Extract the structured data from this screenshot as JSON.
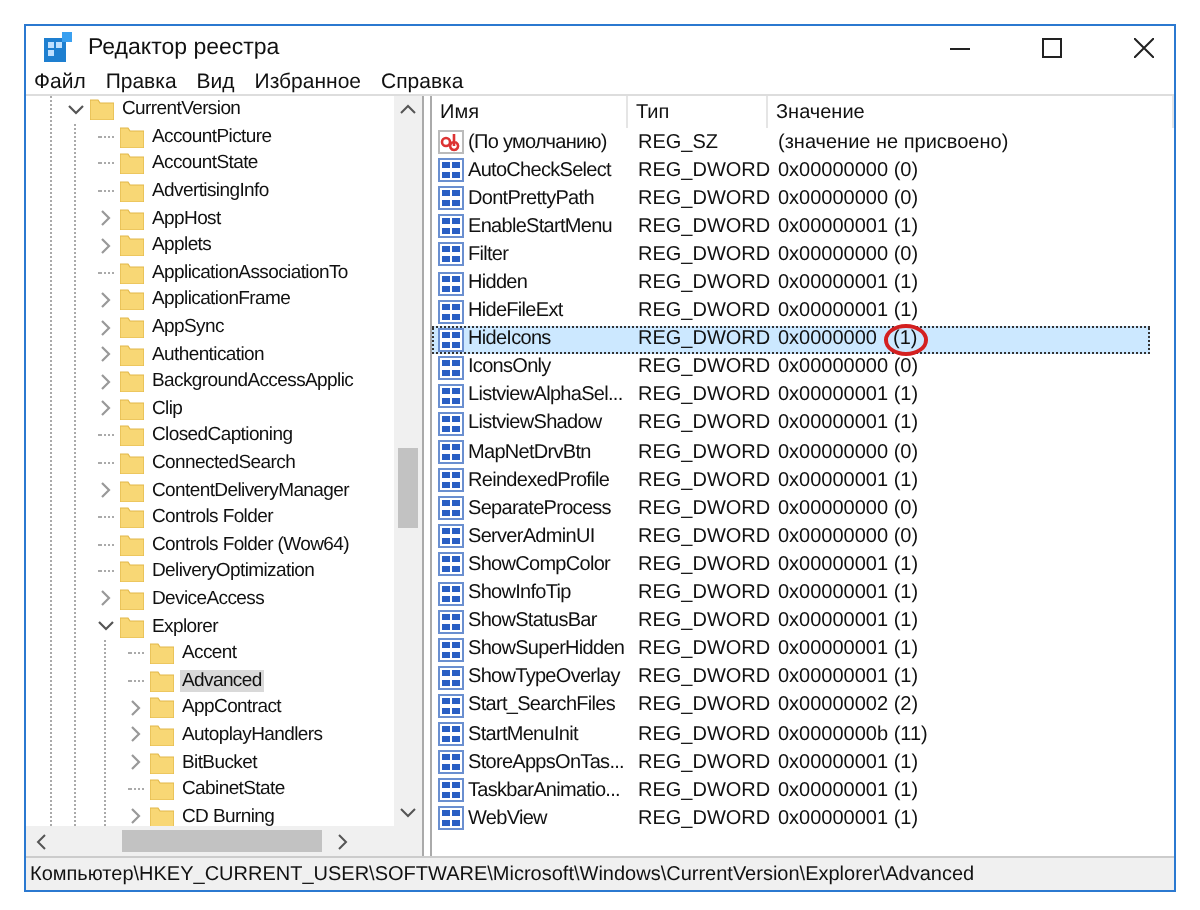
{
  "window": {
    "title": "Редактор реестра"
  },
  "menu": [
    "Файл",
    "Правка",
    "Вид",
    "Избранное",
    "Справка"
  ],
  "tree": [
    {
      "label": "CurrentVersion",
      "expandable": true,
      "selected": false,
      "children": [
        {
          "label": "AccountPicture",
          "expandable": false,
          "selected": false
        },
        {
          "label": "AccountState",
          "expandable": false,
          "selected": false
        },
        {
          "label": "AdvertisingInfo",
          "expandable": false,
          "selected": false
        },
        {
          "label": "AppHost",
          "expandable": true,
          "selected": false
        },
        {
          "label": "Applets",
          "expandable": true,
          "selected": false
        },
        {
          "label": "ApplicationAssociationTo",
          "expandable": false,
          "selected": false
        },
        {
          "label": "ApplicationFrame",
          "expandable": true,
          "selected": false
        },
        {
          "label": "AppSync",
          "expandable": true,
          "selected": false
        },
        {
          "label": "Authentication",
          "expandable": true,
          "selected": false
        },
        {
          "label": "BackgroundAccessApplic",
          "expandable": true,
          "selected": false
        },
        {
          "label": "Clip",
          "expandable": true,
          "selected": false
        },
        {
          "label": "ClosedCaptioning",
          "expandable": false,
          "selected": false
        },
        {
          "label": "ConnectedSearch",
          "expandable": false,
          "selected": false
        },
        {
          "label": "ContentDeliveryManager",
          "expandable": true,
          "selected": false
        },
        {
          "label": "Controls Folder",
          "expandable": false,
          "selected": false
        },
        {
          "label": "Controls Folder (Wow64)",
          "expandable": false,
          "selected": false
        },
        {
          "label": "DeliveryOptimization",
          "expandable": false,
          "selected": false
        },
        {
          "label": "DeviceAccess",
          "expandable": true,
          "selected": false
        },
        {
          "label": "Explorer",
          "expandable": true,
          "selected": false,
          "children": [
            {
              "label": "Accent",
              "expandable": false,
              "selected": false
            },
            {
              "label": "Advanced",
              "expandable": false,
              "selected": true
            },
            {
              "label": "AppContract",
              "expandable": true,
              "selected": false
            },
            {
              "label": "AutoplayHandlers",
              "expandable": true,
              "selected": false
            },
            {
              "label": "BitBucket",
              "expandable": true,
              "selected": false
            },
            {
              "label": "CabinetState",
              "expandable": false,
              "selected": false
            },
            {
              "label": "CD Burning",
              "expandable": true,
              "selected": false
            }
          ]
        }
      ]
    }
  ],
  "values": {
    "columns": [
      "Имя",
      "Тип",
      "Значение"
    ],
    "rows": [
      {
        "kind": "string",
        "name": "(По умолчанию)",
        "type": "REG_SZ",
        "value": "(значение не присвоено)",
        "selected": false
      },
      {
        "kind": "dword",
        "name": "AutoCheckSelect",
        "type": "REG_DWORD",
        "value": "0x00000000 (0)",
        "selected": false
      },
      {
        "kind": "dword",
        "name": "DontPrettyPath",
        "type": "REG_DWORD",
        "value": "0x00000000 (0)",
        "selected": false
      },
      {
        "kind": "dword",
        "name": "EnableStartMenu",
        "type": "REG_DWORD",
        "value": "0x00000001 (1)",
        "selected": false
      },
      {
        "kind": "dword",
        "name": "Filter",
        "type": "REG_DWORD",
        "value": "0x00000000 (0)",
        "selected": false
      },
      {
        "kind": "dword",
        "name": "Hidden",
        "type": "REG_DWORD",
        "value": "0x00000001 (1)",
        "selected": false
      },
      {
        "kind": "dword",
        "name": "HideFileExt",
        "type": "REG_DWORD",
        "value": "0x00000001 (1)",
        "selected": false
      },
      {
        "kind": "dword",
        "name": "HideIcons",
        "type": "REG_DWORD",
        "value": "0x0000000",
        "highlight": "(1)",
        "selected": true
      },
      {
        "kind": "dword",
        "name": "IconsOnly",
        "type": "REG_DWORD",
        "value": "0x00000000 (0)",
        "selected": false
      },
      {
        "kind": "dword",
        "name": "ListviewAlphaSel...",
        "type": "REG_DWORD",
        "value": "0x00000001 (1)",
        "selected": false
      },
      {
        "kind": "dword",
        "name": "ListviewShadow",
        "type": "REG_DWORD",
        "value": "0x00000001 (1)",
        "selected": false
      },
      {
        "kind": "dword",
        "name": "MapNetDrvBtn",
        "type": "REG_DWORD",
        "value": "0x00000000 (0)",
        "selected": false
      },
      {
        "kind": "dword",
        "name": "ReindexedProfile",
        "type": "REG_DWORD",
        "value": "0x00000001 (1)",
        "selected": false
      },
      {
        "kind": "dword",
        "name": "SeparateProcess",
        "type": "REG_DWORD",
        "value": "0x00000000 (0)",
        "selected": false
      },
      {
        "kind": "dword",
        "name": "ServerAdminUI",
        "type": "REG_DWORD",
        "value": "0x00000000 (0)",
        "selected": false
      },
      {
        "kind": "dword",
        "name": "ShowCompColor",
        "type": "REG_DWORD",
        "value": "0x00000001 (1)",
        "selected": false
      },
      {
        "kind": "dword",
        "name": "ShowInfoTip",
        "type": "REG_DWORD",
        "value": "0x00000001 (1)",
        "selected": false
      },
      {
        "kind": "dword",
        "name": "ShowStatusBar",
        "type": "REG_DWORD",
        "value": "0x00000001 (1)",
        "selected": false
      },
      {
        "kind": "dword",
        "name": "ShowSuperHidden",
        "type": "REG_DWORD",
        "value": "0x00000001 (1)",
        "selected": false
      },
      {
        "kind": "dword",
        "name": "ShowTypeOverlay",
        "type": "REG_DWORD",
        "value": "0x00000001 (1)",
        "selected": false
      },
      {
        "kind": "dword",
        "name": "Start_SearchFiles",
        "type": "REG_DWORD",
        "value": "0x00000002 (2)",
        "selected": false
      },
      {
        "kind": "dword",
        "name": "StartMenuInit",
        "type": "REG_DWORD",
        "value": "0x0000000b (11)",
        "selected": false
      },
      {
        "kind": "dword",
        "name": "StoreAppsOnTas...",
        "type": "REG_DWORD",
        "value": "0x00000001 (1)",
        "selected": false
      },
      {
        "kind": "dword",
        "name": "TaskbarAnimatio...",
        "type": "REG_DWORD",
        "value": "0x00000001 (1)",
        "selected": false
      },
      {
        "kind": "dword",
        "name": "WebView",
        "type": "REG_DWORD",
        "value": "0x00000001 (1)",
        "selected": false
      }
    ]
  },
  "status_bar": "Компьютер\\HKEY_CURRENT_USER\\SOFTWARE\\Microsoft\\Windows\\CurrentVersion\\Explorer\\Advanced"
}
